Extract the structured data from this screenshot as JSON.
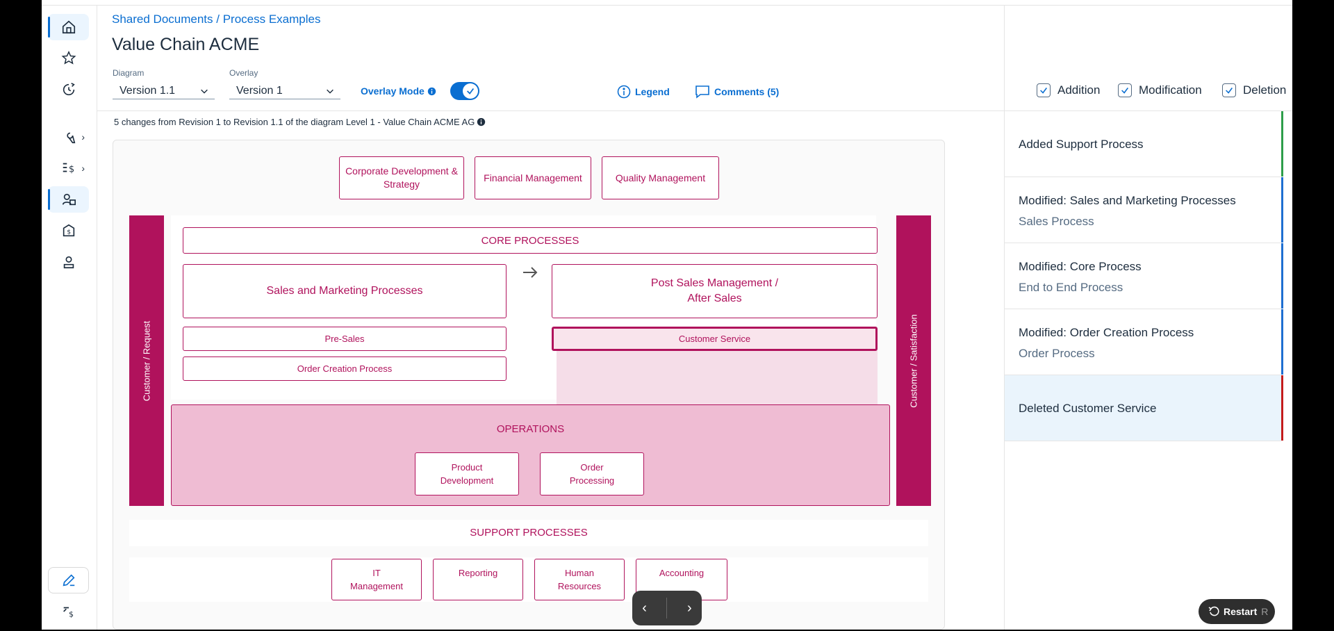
{
  "breadcrumb": "Shared Documents / Process Examples",
  "page_title": "Value Chain ACME",
  "diagram_select": {
    "label": "Diagram",
    "value": "Version 1.1"
  },
  "overlay_select": {
    "label": "Overlay",
    "value": "Version 1"
  },
  "overlay_mode": {
    "label": "Overlay Mode",
    "enabled": true
  },
  "legend_label": "Legend",
  "comments_label": "Comments (5)",
  "filters": {
    "addition": "Addition",
    "modification": "Modification",
    "deletion": "Deletion"
  },
  "changes_summary": "5 changes from Revision 1 to Revision 1.1 of the diagram Level 1 - Value Chain ACME AG",
  "diagram": {
    "top_boxes": [
      "Corporate Development & Strategy",
      "Financial Management",
      "Quality Management"
    ],
    "left_bar": "Customer / Request",
    "right_bar": "Customer / Satisfaction",
    "core_title": "CORE PROCESSES",
    "sales_marketing": "Sales and Marketing Processes",
    "post_sales": "Post Sales Management / After Sales",
    "pre_sales": "Pre-Sales",
    "customer_service": "Customer Service",
    "order_creation": "Order Creation Process",
    "operations_title": "OPERATIONS",
    "product_development": "Product Development",
    "order_processing": "Order Processing",
    "support_title": "SUPPORT PROCESSES",
    "support_boxes": [
      "IT Management",
      "Reporting",
      "Human Resources",
      "Accounting"
    ]
  },
  "change_list": [
    {
      "title": "Added Support Process",
      "subtitle": "",
      "color": "#2e9e4a"
    },
    {
      "title": "Modified: Sales and Marketing Processes",
      "subtitle": "Sales Process",
      "color": "#1f6fd1"
    },
    {
      "title": "Modified: Core Process",
      "subtitle": "End to End Process",
      "color": "#1f6fd1"
    },
    {
      "title": "Modified: Order Creation Process",
      "subtitle": "Order Process",
      "color": "#1f6fd1"
    },
    {
      "title": "Deleted Customer Service",
      "subtitle": "",
      "color": "#c41c1c"
    }
  ],
  "restart": {
    "label": "Restart",
    "key": "R"
  },
  "colors": {
    "accent": "#0a6ed1",
    "process": "#b0125c",
    "operations_fill": "#efbcd3",
    "selected_row": "#eaf4fc"
  }
}
